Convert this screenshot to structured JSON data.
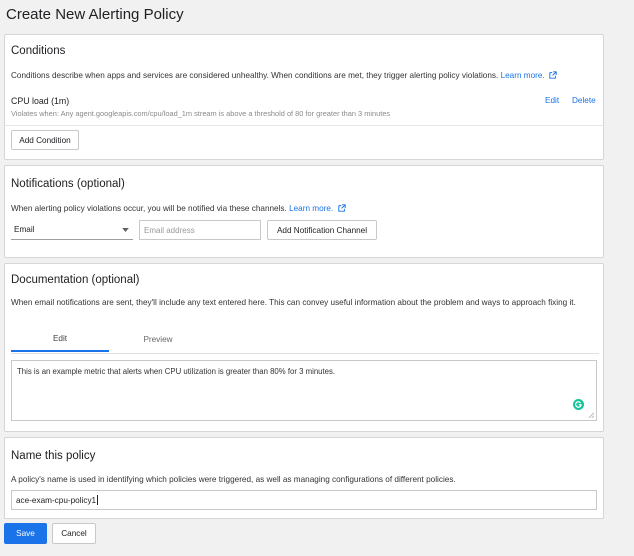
{
  "page": {
    "title": "Create New Alerting Policy"
  },
  "conditions": {
    "title": "Conditions",
    "description": "Conditions describe when apps and services are considered unhealthy. When conditions are met, they trigger alerting policy violations.",
    "learn_more": "Learn more.",
    "item": {
      "name": "CPU load (1m)",
      "violates": "Violates when: Any agent.googleapis.com/cpu/load_1m stream is above a threshold of 80 for greater than 3 minutes",
      "edit": "Edit",
      "delete": "Delete"
    },
    "add_button": "Add Condition"
  },
  "notifications": {
    "title": "Notifications (optional)",
    "description": "When alerting policy violations occur, you will be notified via these channels.",
    "learn_more": "Learn more.",
    "channel_type": "Email",
    "email_placeholder": "Email address",
    "add_button": "Add Notification Channel"
  },
  "documentation": {
    "title": "Documentation (optional)",
    "description": "When email notifications are sent, they'll include any text entered here. This can convey useful information about the problem and ways to approach fixing it.",
    "tabs": [
      "Edit",
      "Preview"
    ],
    "text": "This is an example metric that alerts when CPU utilization is greater than 80% for 3 minutes."
  },
  "name_policy": {
    "title": "Name this policy",
    "description": "A policy's name is used in identifying which policies were triggered, as well as managing configurations of different policies.",
    "value": "ace-exam-cpu-policy1"
  },
  "actions": {
    "save": "Save",
    "cancel": "Cancel"
  },
  "colors": {
    "accent": "#1a73e8",
    "grammarly": "#15c39a"
  }
}
